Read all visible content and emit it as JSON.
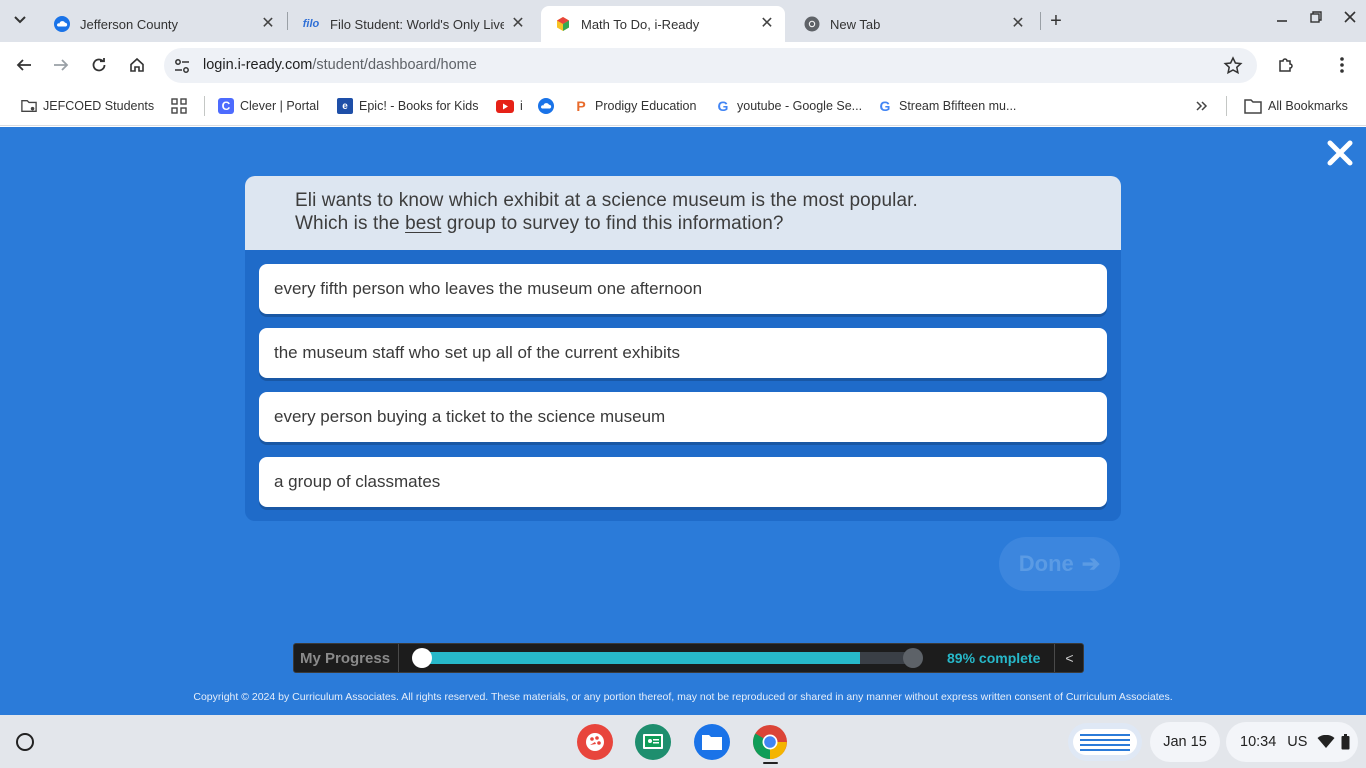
{
  "browser": {
    "tabs": [
      {
        "title": "Jefferson County",
        "favicon": "cloud-icon"
      },
      {
        "title": "Filo Student: World's Only Live I",
        "favicon": "filo-logo"
      },
      {
        "title": "Math To Do, i-Ready",
        "favicon": "iready-cube-icon",
        "active": true
      },
      {
        "title": "New Tab",
        "favicon": "chrome-icon"
      }
    ],
    "url": {
      "host": "login.i-ready.com",
      "path": "/student/dashboard/home"
    },
    "bookmarks": [
      {
        "label": "JEFCOED Students",
        "icon": "folder-gear-icon"
      },
      {
        "label": "",
        "icon": "apps-grid-icon"
      },
      {
        "label": "Clever | Portal",
        "icon": "clever-icon"
      },
      {
        "label": "Epic! - Books for Kids",
        "icon": "epic-icon"
      },
      {
        "label": "i",
        "icon": "youtube-icon"
      },
      {
        "label": "",
        "icon": "cloud-icon"
      },
      {
        "label": "Prodigy Education",
        "icon": "prodigy-icon"
      },
      {
        "label": "youtube - Google Se...",
        "icon": "google-icon"
      },
      {
        "label": "Stream Bfifteen mu...",
        "icon": "google-icon"
      }
    ],
    "all_bookmarks_label": "All Bookmarks"
  },
  "question": {
    "line1": "Eli wants to know which exhibit at a science museum is the most popular.",
    "line2_before": "Which is the ",
    "line2_emphasis": "best",
    "line2_after": " group to survey to find this information?"
  },
  "choices": [
    "every fifth person who leaves the museum one afternoon",
    "the museum staff who set up all of the current exhibits",
    "every person buying a ticket to the science museum",
    "a group of classmates"
  ],
  "done_label": "Done",
  "progress": {
    "label": "My Progress",
    "percent_text": "89% complete",
    "value": 0.89,
    "collapse_glyph": "<"
  },
  "copyright": "Copyright © 2024 by Curriculum Associates. All rights reserved. These materials, or any portion thereof, may not be reproduced or shared in any manner without express written consent of Curriculum Associates.",
  "shelf": {
    "date": "Jan 15",
    "time": "10:34",
    "locale": "US",
    "apps": [
      "canvas-paint-icon",
      "classroom-icon",
      "files-icon",
      "chrome-icon"
    ]
  },
  "colors": {
    "page_bg": "#2b7bd9",
    "progress_fill": "#27b8c9",
    "question_header_bg": "#dde6f1"
  }
}
